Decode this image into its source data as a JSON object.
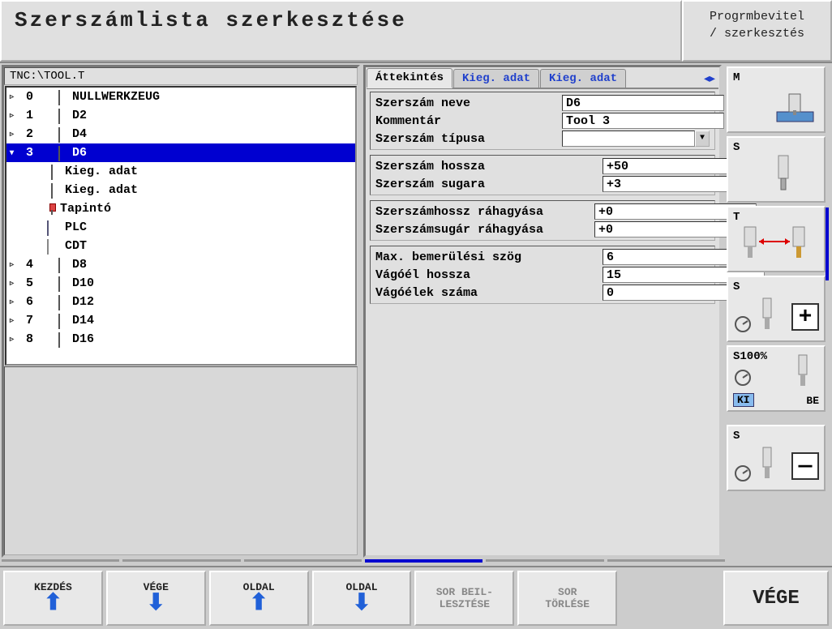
{
  "header": {
    "title": "Szerszámlista szerkesztése",
    "mode_line1": "Progrmbevitel",
    "mode_line2": "/ szerkesztés"
  },
  "path": "TNC:\\TOOL.T",
  "tree": [
    {
      "expand": "▹",
      "num": "0",
      "icon": "mill",
      "name": "NULLWERKZEUG",
      "selected": false
    },
    {
      "expand": "▹",
      "num": "1",
      "icon": "mill",
      "name": "D2",
      "selected": false
    },
    {
      "expand": "▹",
      "num": "2",
      "icon": "mill",
      "name": "D4",
      "selected": false
    },
    {
      "expand": "▾",
      "num": "3",
      "icon": "mill",
      "name": "D6",
      "selected": true
    },
    {
      "expand": "",
      "num": "",
      "icon": "mill",
      "name": "Kieg. adat",
      "child": true
    },
    {
      "expand": "",
      "num": "",
      "icon": "mill-red",
      "name": "Kieg. adat",
      "child": true
    },
    {
      "expand": "",
      "num": "",
      "icon": "probe",
      "name": "Tapintó",
      "child": true
    },
    {
      "expand": "",
      "num": "",
      "icon": "plc",
      "name": "PLC",
      "child": true
    },
    {
      "expand": "",
      "num": "",
      "icon": "cdt",
      "name": "CDT",
      "child": true
    },
    {
      "expand": "▹",
      "num": "4",
      "icon": "mill",
      "name": "D8",
      "selected": false
    },
    {
      "expand": "▹",
      "num": "5",
      "icon": "mill",
      "name": "D10",
      "selected": false
    },
    {
      "expand": "▹",
      "num": "6",
      "icon": "mill",
      "name": "D12",
      "selected": false
    },
    {
      "expand": "▹",
      "num": "7",
      "icon": "mill",
      "name": "D14",
      "selected": false
    },
    {
      "expand": "▹",
      "num": "8",
      "icon": "mill",
      "name": "D16",
      "selected": false
    }
  ],
  "tabs": {
    "t1": "Áttekintés",
    "t2": "Kieg. adat",
    "t3": "Kieg. adat"
  },
  "fields": {
    "g1": {
      "name_lbl": "Szerszám neve",
      "name_val": "D6",
      "comment_lbl": "Kommentár",
      "comment_val": "Tool 3",
      "type_lbl": "Szerszám típusa",
      "type_val": ""
    },
    "g2": {
      "len_lbl": "Szerszám hossza",
      "len_val": "+50",
      "rad_lbl": "Szerszám sugara",
      "rad_val": "+3"
    },
    "g3": {
      "lenov_lbl": "Szerszámhossz ráhagyása",
      "lenov_val": "+0",
      "radov_lbl": "Szerszámsugár ráhagyása",
      "radov_val": "+0"
    },
    "g4": {
      "maxang_lbl": "Max. bemerülési szög",
      "maxang_val": "6",
      "cutlen_lbl": "Vágóél hossza",
      "cutlen_val": "15",
      "cutnum_lbl": "Vágóélek száma",
      "cutnum_val": "0"
    }
  },
  "side": {
    "m": "M",
    "s": "S",
    "t": "T",
    "s2": "S",
    "s100": "S100%",
    "ki": "KI",
    "be": "BE"
  },
  "softkeys": {
    "k1": "KEZDÉS",
    "k2": "VÉGE",
    "k3": "OLDAL",
    "k4": "OLDAL",
    "k5a": "SOR BEIL-",
    "k5b": "LESZTÉSE",
    "k6a": "SOR",
    "k6b": "TÖRLÉSE",
    "end": "VÉGE"
  }
}
